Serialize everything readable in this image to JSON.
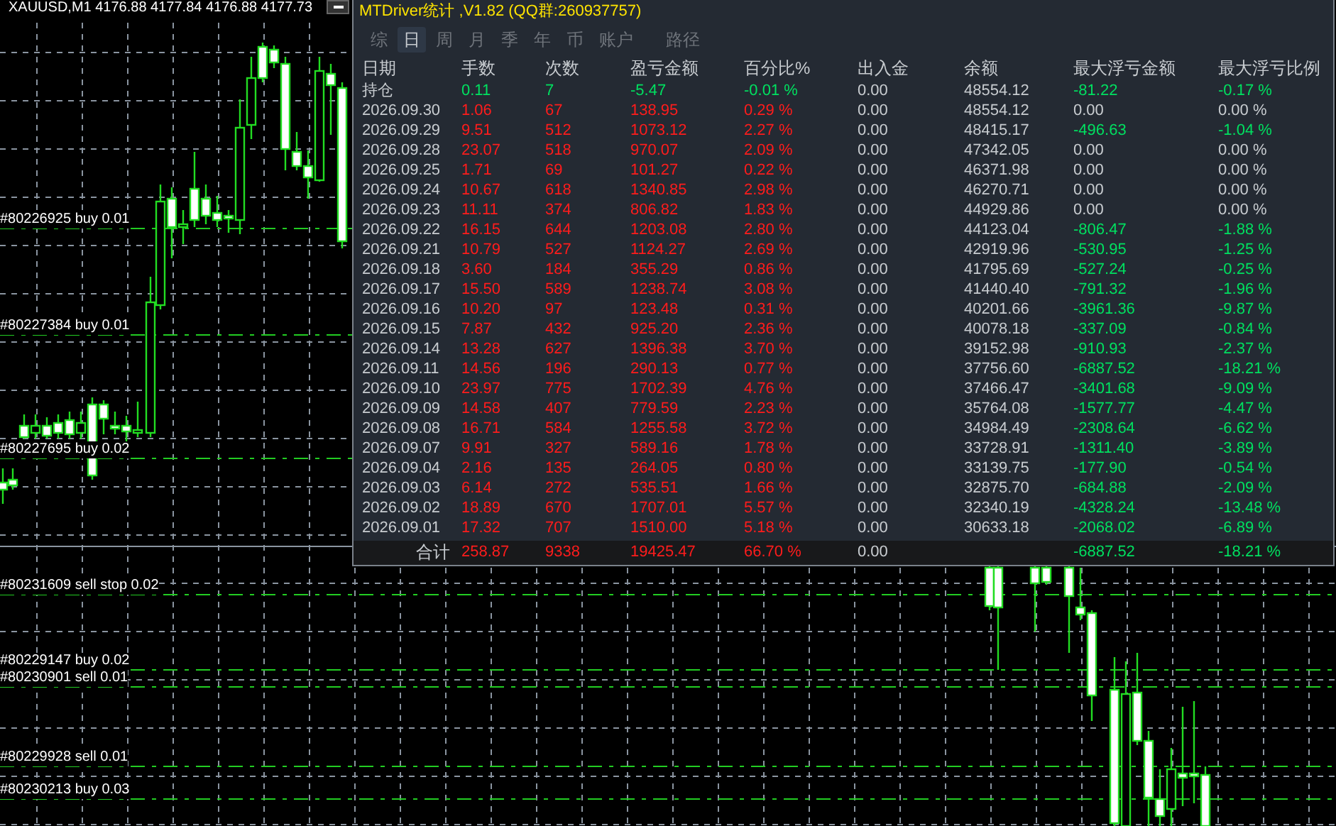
{
  "chart": {
    "symbol_line": "XAUUSD,M1  4176.88 4177.84 4176.88 4177.73",
    "order_labels": [
      "#80226925 buy 0.01",
      "#80227384 buy 0.01",
      "#80227695 buy 0.02",
      "#80231609 sell stop 0.02",
      "#80229147 buy 0.02",
      "#80230901 sell 0.01",
      "#80229928 sell 0.01",
      "#80230213 buy 0.03"
    ]
  },
  "panel": {
    "title": "MTDriver统计 ,V1.82 (QQ群:260937757)",
    "tabs": [
      {
        "label": "综",
        "selected": false
      },
      {
        "label": "日",
        "selected": true
      },
      {
        "label": "周",
        "selected": false
      },
      {
        "label": "月",
        "selected": false
      },
      {
        "label": "季",
        "selected": false
      },
      {
        "label": "年",
        "selected": false
      },
      {
        "label": "币",
        "selected": false
      },
      {
        "label": "账户",
        "selected": false
      },
      {
        "label": "路径",
        "selected": false
      }
    ],
    "columns": [
      "日期",
      "手数",
      "次数",
      "盈亏金额",
      "百分比%",
      "出入金",
      "余额",
      "最大浮亏金额",
      "最大浮亏比例"
    ],
    "rows": [
      {
        "kind": "position",
        "date": "持仓",
        "lots": "0.11",
        "count": "7",
        "pnl": "-5.47",
        "pct": "-0.01 %",
        "flow": "0.00",
        "balance": "48554.12",
        "max_dd": "-81.22",
        "max_dd_pct": "-0.17 %",
        "drawdown": true
      },
      {
        "kind": "day",
        "date": "2026.09.30",
        "lots": "1.06",
        "count": "67",
        "pnl": "138.95",
        "pct": "0.29 %",
        "flow": "0.00",
        "balance": "48554.12",
        "max_dd": "0.00",
        "max_dd_pct": "0.00 %",
        "drawdown": false
      },
      {
        "kind": "day",
        "date": "2026.09.29",
        "lots": "9.51",
        "count": "512",
        "pnl": "1073.12",
        "pct": "2.27 %",
        "flow": "0.00",
        "balance": "48415.17",
        "max_dd": "-496.63",
        "max_dd_pct": "-1.04 %",
        "drawdown": true
      },
      {
        "kind": "day",
        "date": "2026.09.28",
        "lots": "23.07",
        "count": "518",
        "pnl": "970.07",
        "pct": "2.09 %",
        "flow": "0.00",
        "balance": "47342.05",
        "max_dd": "0.00",
        "max_dd_pct": "0.00 %",
        "drawdown": false
      },
      {
        "kind": "day",
        "date": "2026.09.25",
        "lots": "1.71",
        "count": "69",
        "pnl": "101.27",
        "pct": "0.22 %",
        "flow": "0.00",
        "balance": "46371.98",
        "max_dd": "0.00",
        "max_dd_pct": "0.00 %",
        "drawdown": false
      },
      {
        "kind": "day",
        "date": "2026.09.24",
        "lots": "10.67",
        "count": "618",
        "pnl": "1340.85",
        "pct": "2.98 %",
        "flow": "0.00",
        "balance": "46270.71",
        "max_dd": "0.00",
        "max_dd_pct": "0.00 %",
        "drawdown": false
      },
      {
        "kind": "day",
        "date": "2026.09.23",
        "lots": "11.11",
        "count": "374",
        "pnl": "806.82",
        "pct": "1.83 %",
        "flow": "0.00",
        "balance": "44929.86",
        "max_dd": "0.00",
        "max_dd_pct": "0.00 %",
        "drawdown": false
      },
      {
        "kind": "day",
        "date": "2026.09.22",
        "lots": "16.15",
        "count": "644",
        "pnl": "1203.08",
        "pct": "2.80 %",
        "flow": "0.00",
        "balance": "44123.04",
        "max_dd": "-806.47",
        "max_dd_pct": "-1.88 %",
        "drawdown": true
      },
      {
        "kind": "day",
        "date": "2026.09.21",
        "lots": "10.79",
        "count": "527",
        "pnl": "1124.27",
        "pct": "2.69 %",
        "flow": "0.00",
        "balance": "42919.96",
        "max_dd": "-530.95",
        "max_dd_pct": "-1.25 %",
        "drawdown": true
      },
      {
        "kind": "day",
        "date": "2026.09.18",
        "lots": "3.60",
        "count": "184",
        "pnl": "355.29",
        "pct": "0.86 %",
        "flow": "0.00",
        "balance": "41795.69",
        "max_dd": "-527.24",
        "max_dd_pct": "-0.25 %",
        "drawdown": true
      },
      {
        "kind": "day",
        "date": "2026.09.17",
        "lots": "15.50",
        "count": "589",
        "pnl": "1238.74",
        "pct": "3.08 %",
        "flow": "0.00",
        "balance": "41440.40",
        "max_dd": "-791.32",
        "max_dd_pct": "-1.96 %",
        "drawdown": true
      },
      {
        "kind": "day",
        "date": "2026.09.16",
        "lots": "10.20",
        "count": "97",
        "pnl": "123.48",
        "pct": "0.31 %",
        "flow": "0.00",
        "balance": "40201.66",
        "max_dd": "-3961.36",
        "max_dd_pct": "-9.87 %",
        "drawdown": true
      },
      {
        "kind": "day",
        "date": "2026.09.15",
        "lots": "7.87",
        "count": "432",
        "pnl": "925.20",
        "pct": "2.36 %",
        "flow": "0.00",
        "balance": "40078.18",
        "max_dd": "-337.09",
        "max_dd_pct": "-0.84 %",
        "drawdown": true
      },
      {
        "kind": "day",
        "date": "2026.09.14",
        "lots": "13.28",
        "count": "627",
        "pnl": "1396.38",
        "pct": "3.70 %",
        "flow": "0.00",
        "balance": "39152.98",
        "max_dd": "-910.93",
        "max_dd_pct": "-2.37 %",
        "drawdown": true
      },
      {
        "kind": "day",
        "date": "2026.09.11",
        "lots": "14.56",
        "count": "196",
        "pnl": "290.13",
        "pct": "0.77 %",
        "flow": "0.00",
        "balance": "37756.60",
        "max_dd": "-6887.52",
        "max_dd_pct": "-18.21 %",
        "drawdown": true
      },
      {
        "kind": "day",
        "date": "2026.09.10",
        "lots": "23.97",
        "count": "775",
        "pnl": "1702.39",
        "pct": "4.76 %",
        "flow": "0.00",
        "balance": "37466.47",
        "max_dd": "-3401.68",
        "max_dd_pct": "-9.09 %",
        "drawdown": true
      },
      {
        "kind": "day",
        "date": "2026.09.09",
        "lots": "14.58",
        "count": "407",
        "pnl": "779.59",
        "pct": "2.23 %",
        "flow": "0.00",
        "balance": "35764.08",
        "max_dd": "-1577.77",
        "max_dd_pct": "-4.47 %",
        "drawdown": true
      },
      {
        "kind": "day",
        "date": "2026.09.08",
        "lots": "16.71",
        "count": "584",
        "pnl": "1255.58",
        "pct": "3.72 %",
        "flow": "0.00",
        "balance": "34984.49",
        "max_dd": "-2308.64",
        "max_dd_pct": "-6.62 %",
        "drawdown": true
      },
      {
        "kind": "day",
        "date": "2026.09.07",
        "lots": "9.91",
        "count": "327",
        "pnl": "589.16",
        "pct": "1.78 %",
        "flow": "0.00",
        "balance": "33728.91",
        "max_dd": "-1311.40",
        "max_dd_pct": "-3.89 %",
        "drawdown": true
      },
      {
        "kind": "day",
        "date": "2026.09.04",
        "lots": "2.16",
        "count": "135",
        "pnl": "264.05",
        "pct": "0.80 %",
        "flow": "0.00",
        "balance": "33139.75",
        "max_dd": "-177.90",
        "max_dd_pct": "-0.54 %",
        "drawdown": true
      },
      {
        "kind": "day",
        "date": "2026.09.03",
        "lots": "6.14",
        "count": "272",
        "pnl": "535.51",
        "pct": "1.66 %",
        "flow": "0.00",
        "balance": "32875.70",
        "max_dd": "-684.88",
        "max_dd_pct": "-2.09 %",
        "drawdown": true
      },
      {
        "kind": "day",
        "date": "2026.09.02",
        "lots": "18.89",
        "count": "670",
        "pnl": "1707.01",
        "pct": "5.57 %",
        "flow": "0.00",
        "balance": "32340.19",
        "max_dd": "-4328.24",
        "max_dd_pct": "-13.48 %",
        "drawdown": true
      },
      {
        "kind": "day",
        "date": "2026.09.01",
        "lots": "17.32",
        "count": "707",
        "pnl": "1510.00",
        "pct": "5.18 %",
        "flow": "0.00",
        "balance": "30633.18",
        "max_dd": "-2068.02",
        "max_dd_pct": "-6.89 %",
        "drawdown": true
      },
      {
        "kind": "total",
        "date": "合计",
        "lots": "258.87",
        "count": "9338",
        "pnl": "19425.47",
        "pct": "66.70 %",
        "flow": "0.00",
        "max_dd": "-6887.52",
        "max_dd_pct": "-18.21 %",
        "drawdown": true
      }
    ]
  }
}
